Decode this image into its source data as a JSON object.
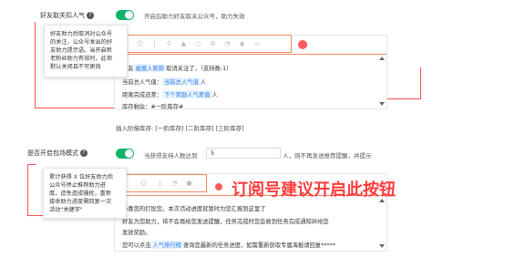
{
  "row1": {
    "label": "好友取关扣人气",
    "help": "?",
    "toggle_on": true,
    "description": "开启后助力好友取关公众号，助力失效",
    "tooltip": [
      "好友助力后取消对公众号",
      "的关注，公众号发出的好",
      "友助力提示语。当开启新",
      "老粉丝助力有效时，此项",
      "默认关闭且不可更改"
    ],
    "editor_lines": {
      "l1_pre": "好友",
      "l1_chip": "被邀人昵称",
      "l1_post": "取消关注了，（支持数-1）",
      "l2_pre": "当前总人气值：",
      "l2_chip": "当前总人气值",
      "l2_post": "人",
      "l3_pre": "距离完成还差：",
      "l3_chip": "下个奖励人气差值",
      "l3_post": "人",
      "l4": "库存剩余：#一阶库存#"
    },
    "insert_label": "插入阶梯库存:",
    "insert_links": [
      "[一阶库存]",
      "[二阶库存]",
      "[三阶库存]"
    ]
  },
  "row2": {
    "label": "是否开启包场模式",
    "help": "?",
    "toggle_on": true,
    "description_pre": "当获得支持人数达到",
    "input_value": "5",
    "description_post": "人，则不再发送推荐提醒，并提示",
    "tooltip": [
      "累计获得 X 位好友助力后",
      "公众号停止推荐助力进",
      "度，造免造成骚扰，重新",
      "接收助力进度需回复一次",
      "活动\"关键字\""
    ],
    "editor_lines": {
      "l1": "恭喜您的打投您，本次活动进度就暂时为您汇报到这里了",
      "l2": "好友为您助力，将不会再给您发送提醒，任务完成时您会收到任务完成通知并给您",
      "l3": "发放奖励。",
      "l4_pre": "您可以点击",
      "l4_chip": "人气排行榜",
      "l4_post": "查询您最新的任务进度，如需重新获取专属海报请回复*****"
    }
  },
  "annotation": {
    "text": "订阅号建议开启此按钮"
  },
  "colors": {
    "toggle": "#11b46b",
    "highlight": "#ff3b3b",
    "chip_text": "#2c7be5"
  }
}
